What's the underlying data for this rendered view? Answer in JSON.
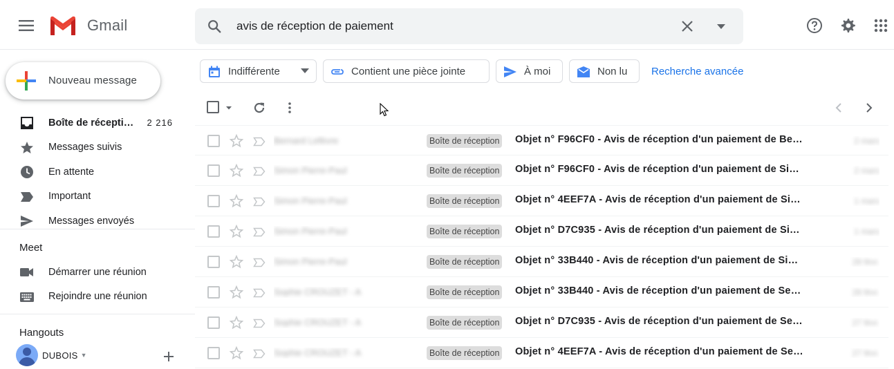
{
  "header": {
    "logo_text": "Gmail",
    "search_value": "avis de réception de paiement"
  },
  "sidebar": {
    "compose_label": "Nouveau message",
    "items": [
      {
        "label": "Boîte de récepti…",
        "count": "2 216",
        "bold": true,
        "icon": "inbox-icon"
      },
      {
        "label": "Messages suivis",
        "count": "",
        "bold": false,
        "icon": "star-icon"
      },
      {
        "label": "En attente",
        "count": "",
        "bold": false,
        "icon": "clock-icon"
      },
      {
        "label": "Important",
        "count": "",
        "bold": false,
        "icon": "label-important-icon"
      },
      {
        "label": "Messages envoyés",
        "count": "",
        "bold": false,
        "icon": "send-icon"
      }
    ],
    "meet": {
      "title": "Meet",
      "items": [
        {
          "label": "Démarrer une réunion",
          "icon": "video-camera-icon"
        },
        {
          "label": "Rejoindre une réunion",
          "icon": "keyboard-icon"
        }
      ]
    },
    "hangouts": {
      "title": "Hangouts",
      "user_name": "DUBOIS"
    }
  },
  "filters": {
    "chips": [
      {
        "label": "Indifférente",
        "icon": "calendar-icon",
        "has_caret": true
      },
      {
        "label": "Contient une pièce jointe",
        "icon": "attachment-icon",
        "has_caret": false
      },
      {
        "label": "À moi",
        "icon": "send-arrow-icon",
        "has_caret": false
      },
      {
        "label": "Non lu",
        "icon": "unread-mail-icon",
        "has_caret": false
      }
    ],
    "advanced_link": "Recherche avancée"
  },
  "emails": [
    {
      "sender": "Bernard Lefèvre",
      "label": "Boîte de réception",
      "subject": "Objet n° F96CF0 - Avis de réception d'un paiement de Ber…",
      "date": "2 mars"
    },
    {
      "sender": "Simon Pierre-Paul",
      "label": "Boîte de réception",
      "subject": "Objet n° F96CF0 - Avis de réception d'un paiement de Si…",
      "date": "2 mars"
    },
    {
      "sender": "Simon Pierre-Paul",
      "label": "Boîte de réception",
      "subject": "Objet n° 4EEF7A - Avis de réception d'un paiement de Si…",
      "date": "1 mars"
    },
    {
      "sender": "Simon Pierre-Paul",
      "label": "Boîte de réception",
      "subject": "Objet n° D7C935 - Avis de réception d'un paiement de Si…",
      "date": "1 mars"
    },
    {
      "sender": "Simon Pierre-Paul",
      "label": "Boîte de réception",
      "subject": "Objet n° 33B440 - Avis de réception d'un paiement de Si…",
      "date": "28 févr."
    },
    {
      "sender": "Sophie CROUZET - A",
      "label": "Boîte de réception",
      "subject": "Objet n° 33B440 - Avis de réception d'un paiement de Se…",
      "date": "28 févr."
    },
    {
      "sender": "Sophie CROUZET - A",
      "label": "Boîte de réception",
      "subject": "Objet n° D7C935 - Avis de réception d'un paiement de Se…",
      "date": "27 févr."
    },
    {
      "sender": "Sophie CROUZET - A",
      "label": "Boîte de réception",
      "subject": "Objet n° 4EEF7A - Avis de réception d'un paiement de Se…",
      "date": "27 févr."
    }
  ]
}
